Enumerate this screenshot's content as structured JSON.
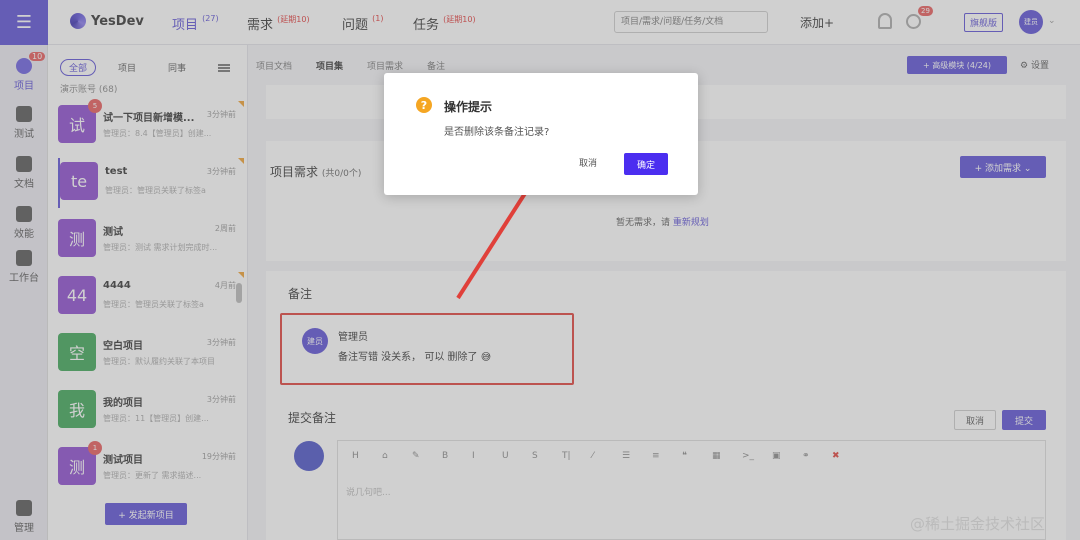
{
  "rail": {
    "items": [
      {
        "label": "项目",
        "icon": "project-icon",
        "badge": "10"
      },
      {
        "label": "测试",
        "icon": "test-icon"
      },
      {
        "label": "文档",
        "icon": "doc-icon"
      },
      {
        "label": "效能",
        "icon": "chart-icon"
      },
      {
        "label": "工作台",
        "icon": "workbench-icon"
      },
      {
        "label": "管理",
        "icon": "admin-icon"
      }
    ]
  },
  "topbar": {
    "logo": "YesDev",
    "nav": [
      {
        "label": "项目",
        "sup": "(27)"
      },
      {
        "label": "需求",
        "sup": "(延期10)"
      },
      {
        "label": "问题",
        "sup": "(1)"
      },
      {
        "label": "任务",
        "sup": "(延期10)"
      }
    ],
    "search_placeholder": "项目/需求/问题/任务/文档",
    "add_label": "添加+",
    "clock_badge": "29",
    "edition": "旗舰版",
    "avatar": "建员"
  },
  "list": {
    "filters": [
      "全部",
      "项目",
      "同事"
    ],
    "demo_count": "演示账号 (68)",
    "projects": [
      {
        "glyph": "试",
        "name": "试一下项目新增模...",
        "time": "3分钟前",
        "desc": "管理员：8.4【管理员】创建...",
        "badge": "5"
      },
      {
        "glyph": "te",
        "name": "test",
        "time": "3分钟前",
        "desc": "管理员：管理员关联了标签a"
      },
      {
        "glyph": "测",
        "name": "测试",
        "time": "2周前",
        "desc": "管理员：测试 需求计划完成时..."
      },
      {
        "glyph": "44",
        "name": "4444",
        "time": "4月前",
        "desc": "管理员：管理员关联了标签a"
      },
      {
        "glyph": "空",
        "name": "空白项目",
        "time": "3分钟前",
        "desc": "管理员：默认履约关联了本项目"
      },
      {
        "glyph": "我",
        "name": "我的项目",
        "time": "3分钟前",
        "desc": "管理员：11【管理员】创建..."
      },
      {
        "glyph": "测",
        "name": "测试项目",
        "time": "19分钟前",
        "desc": "管理员：更新了 需求描述...",
        "badge": "1"
      }
    ],
    "new_project": "+ 发起新项目"
  },
  "main": {
    "tabs": [
      "项目文档",
      "项目集",
      "项目需求",
      "备注"
    ],
    "upgrade": "+ 高级模块 (4/24)",
    "settings": "设置",
    "req_title": "项目需求",
    "req_count": "(共0/0个)",
    "add_req": "+ 添加需求 ⌄",
    "empty_req": "暂无需求，请",
    "empty_req_link": "重新规划",
    "note_title": "备注",
    "note_avatar": "建员",
    "note_user": "管理员",
    "note_text": "备注写错 没关系， 可以 删除了",
    "submit_title": "提交备注",
    "cancel": "取消",
    "submit": "提交",
    "toolbar": [
      "H",
      "⌂",
      "✎",
      "B",
      "I",
      "U",
      "S",
      "T|",
      "⁄",
      "☰",
      "≡",
      "❝",
      "▦",
      ">_",
      "▣",
      "⚭",
      "✖"
    ],
    "editor_placeholder": "说几句吧..."
  },
  "dialog": {
    "icon": "?",
    "title": "操作提示",
    "message": "是否删除该条备注记录?",
    "cancel": "取消",
    "ok": "确定"
  },
  "watermark": "@稀土掘金技术社区",
  "colors": {
    "accent": "#5b4fd6",
    "highlight": "#e0403a"
  }
}
